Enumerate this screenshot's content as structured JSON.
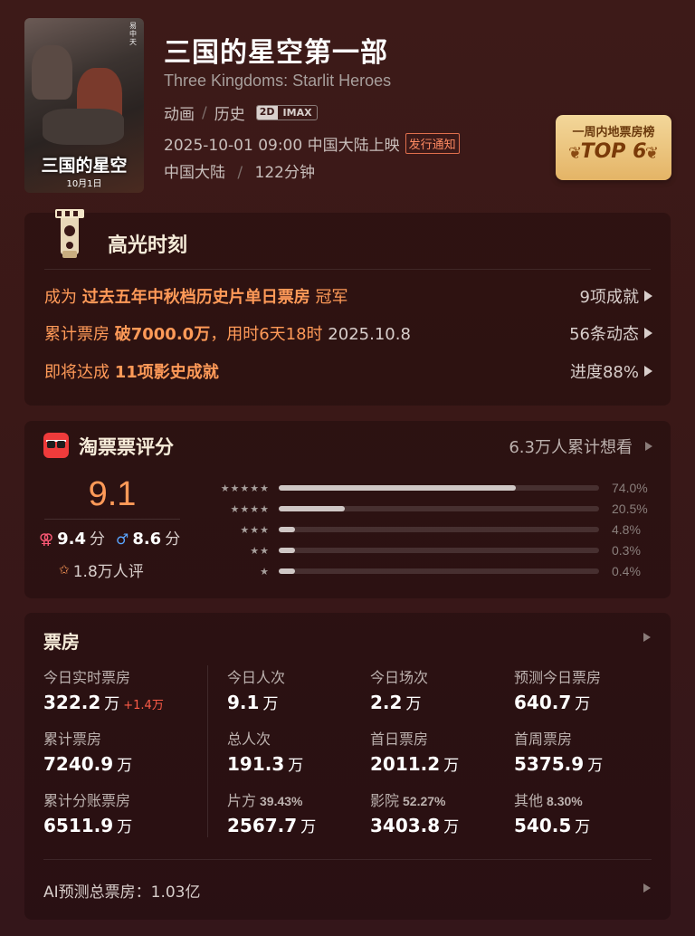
{
  "movie": {
    "title": "三国的星空第一部",
    "title_en": "Three Kingdoms: Starlit Heroes",
    "genres": [
      "动画",
      "历史"
    ],
    "formats": [
      "2D",
      "IMAX"
    ],
    "release": "2025-10-01 09:00 中国大陆上映",
    "release_tag": "发行通知",
    "region": "中国大陆",
    "duration": "122分钟",
    "poster": {
      "title": "三国的星空",
      "date": "10月1日",
      "side_text": "易中天"
    }
  },
  "rank_badge": {
    "top_label": "一周内地票房榜",
    "main_label": "TOP 6"
  },
  "highlights": {
    "title": "高光时刻",
    "rows": [
      {
        "pre": "成为",
        "emphasis": "过去五年中秋档历史片单日票房",
        "post": "冠军",
        "right": "9项成就"
      },
      {
        "pre": "累计票房",
        "emphasis": "破7000.0万",
        "post": "，用时6天18时",
        "date": "2025.10.8",
        "right": "56条动态"
      },
      {
        "pre": "即将达成",
        "emphasis": "11项影史成就",
        "post": "",
        "right": "进度88%"
      }
    ]
  },
  "rating": {
    "title": "淘票票评分",
    "want": "6.3万人累计想看",
    "score": "9.1",
    "female_score": "9.4",
    "male_score": "8.6",
    "score_unit": "分",
    "count": "1.8万人评",
    "distribution": [
      {
        "stars": "★★★★★",
        "pct_label": "74.0%",
        "pct": 74.0
      },
      {
        "stars": "★★★★",
        "pct_label": "20.5%",
        "pct": 20.5
      },
      {
        "stars": "★★★",
        "pct_label": "4.8%",
        "pct": 4.8
      },
      {
        "stars": "★★",
        "pct_label": "0.3%",
        "pct": 0.3
      },
      {
        "stars": "★",
        "pct_label": "0.4%",
        "pct": 0.4
      }
    ]
  },
  "box_office": {
    "title": "票房",
    "cells": [
      {
        "label": "今日实时票房",
        "value": "322.2",
        "unit": "万",
        "delta": "+1.4万"
      },
      {
        "label": "今日人次",
        "value": "9.1",
        "unit": "万"
      },
      {
        "label": "今日场次",
        "value": "2.2",
        "unit": "万"
      },
      {
        "label": "预测今日票房",
        "value": "640.7",
        "unit": "万"
      },
      {
        "label": "累计票房",
        "value": "7240.9",
        "unit": "万"
      },
      {
        "label": "总人次",
        "value": "191.3",
        "unit": "万"
      },
      {
        "label": "首日票房",
        "value": "2011.2",
        "unit": "万"
      },
      {
        "label": "首周票房",
        "value": "5375.9",
        "unit": "万"
      },
      {
        "label": "累计分账票房",
        "value": "6511.9",
        "unit": "万"
      },
      {
        "label": "片方",
        "sub": "39.43%",
        "value": "2567.7",
        "unit": "万"
      },
      {
        "label": "影院",
        "sub": "52.27%",
        "value": "3403.8",
        "unit": "万"
      },
      {
        "label": "其他",
        "sub": "8.30%",
        "value": "540.5",
        "unit": "万"
      }
    ],
    "ai_forecast": "AI预测总票房：1.03亿"
  },
  "colors": {
    "accent_orange": "#ff9a58",
    "background": "#3d1a18",
    "badge_gold": "#e4b466",
    "delta_red": "#ff5c48"
  }
}
